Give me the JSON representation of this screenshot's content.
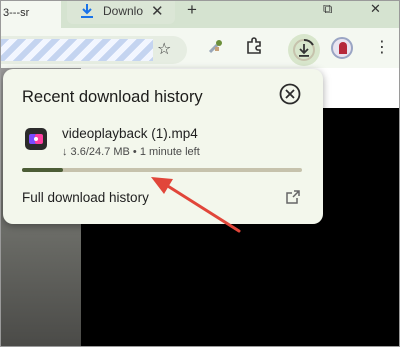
{
  "tabs": [
    {
      "label": "3---sr"
    },
    {
      "label": "Downlo",
      "close": "✕"
    }
  ],
  "new_tab_symbol": "+",
  "window_controls": {
    "restore": "⧉",
    "close": "✕"
  },
  "toolbar": {
    "star_symbol": "☆",
    "menu_symbol": "⋮"
  },
  "popup": {
    "title": "Recent download history",
    "file_name": "videoplayback (1).mp4",
    "file_status": "↓ 3.6/24.7 MB • 1 minute left",
    "progress_fraction": 0.146,
    "full_history_label": "Full download history"
  },
  "colors": {
    "accent": "#4c5d36",
    "annotation_arrow": "#e1463a",
    "popup_bg": "#f3f7ec"
  },
  "icons": [
    "download-icon",
    "close-icon",
    "star-icon",
    "eyedropper-icon",
    "extensions-icon",
    "download-progress-icon",
    "avatar",
    "menu-icon",
    "close-circle-icon",
    "file-icon",
    "open-external-icon"
  ]
}
